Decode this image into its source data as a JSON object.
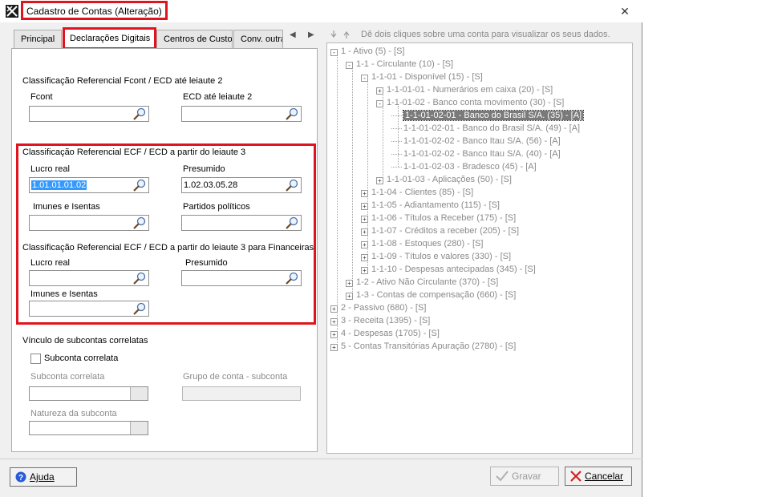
{
  "window": {
    "title": "Cadastro de Contas (Alteração)"
  },
  "tabs": [
    {
      "label": "Principal"
    },
    {
      "label": "Declarações Digitais"
    },
    {
      "label": "Centros de Custo"
    },
    {
      "label": "Conv. outra"
    }
  ],
  "form": {
    "section1": {
      "title": "Classificação Referencial Fcont / ECD até leiaute 2",
      "fcont_label": "Fcont",
      "fcont_value": "",
      "ecd_label": "ECD até leiaute 2",
      "ecd_value": ""
    },
    "section2": {
      "title": "Classificação Referencial ECF / ECD a partir do leiaute 3",
      "lucro_real_label": "Lucro real",
      "lucro_real_value": "1.01.01.01.02",
      "presumido_label": "Presumido",
      "presumido_value": "1.02.03.05.28",
      "imunes_label": "Imunes e Isentas",
      "imunes_value": "",
      "partidos_label": "Partidos políticos",
      "partidos_value": ""
    },
    "section3": {
      "title": "Classificação Referencial ECF / ECD a partir do leiaute 3 para Financeiras",
      "lucro_real_label": "Lucro real",
      "lucro_real_value": "",
      "presumido_label": "Presumido",
      "presumido_value": "",
      "imunes_label": "Imunes e Isentas",
      "imunes_value": ""
    },
    "section4": {
      "title": "Vínculo de subcontas correlatas",
      "checkbox_label": "Subconta correlata",
      "subconta_label": "Subconta correlata",
      "grupo_label": "Grupo de conta - subconta",
      "natureza_label": "Natureza da subconta"
    }
  },
  "tree": {
    "hint": "Dê dois cliques sobre uma conta para visualizar os seus dados.",
    "nodes": [
      {
        "text": "1 - Ativo (5) - [S]",
        "level": 0,
        "exp": "-"
      },
      {
        "text": "1-1 - Circulante (10) - [S]",
        "level": 1,
        "exp": "-"
      },
      {
        "text": "1-1-01 - Disponível (15) - [S]",
        "level": 2,
        "exp": "-"
      },
      {
        "text": "1-1-01-01 - Numerários em caixa (20) - [S]",
        "level": 3,
        "exp": "+"
      },
      {
        "text": "1-1-01-02 - Banco conta movimento (30) - [S]",
        "level": 3,
        "exp": "-"
      },
      {
        "text": "1-1-01-02-01 - Banco do Brasil S/A. (35) - [A]",
        "level": 4,
        "exp": "",
        "selected": true
      },
      {
        "text": "1-1-01-02-01 - Banco do Brasil S/A. (49) - [A]",
        "level": 4,
        "exp": ""
      },
      {
        "text": "1-1-01-02-02 - Banco Itau S/A. (56) - [A]",
        "level": 4,
        "exp": ""
      },
      {
        "text": "1-1-01-02-02 - Banco Itau S/A. (40) - [A]",
        "level": 4,
        "exp": ""
      },
      {
        "text": "1-1-01-02-03 - Bradesco (45) - [A]",
        "level": 4,
        "exp": ""
      },
      {
        "text": "1-1-01-03 - Aplicações (50) - [S]",
        "level": 3,
        "exp": "+"
      },
      {
        "text": "1-1-04 - Clientes (85) - [S]",
        "level": 2,
        "exp": "+"
      },
      {
        "text": "1-1-05 - Adiantamento (115) - [S]",
        "level": 2,
        "exp": "+"
      },
      {
        "text": "1-1-06 - Títulos a Receber (175) - [S]",
        "level": 2,
        "exp": "+"
      },
      {
        "text": "1-1-07 - Créditos a receber (205) - [S]",
        "level": 2,
        "exp": "+"
      },
      {
        "text": "1-1-08 - Estoques (280) - [S]",
        "level": 2,
        "exp": "+"
      },
      {
        "text": "1-1-09 - Títulos e valores (330) - [S]",
        "level": 2,
        "exp": "+"
      },
      {
        "text": "1-1-10 - Despesas antecipadas (345) - [S]",
        "level": 2,
        "exp": "+"
      },
      {
        "text": "1-2 - Ativo Não Circulante (370) - [S]",
        "level": 1,
        "exp": "+"
      },
      {
        "text": "1-3 - Contas de compensação (660) - [S]",
        "level": 1,
        "exp": "+"
      },
      {
        "text": "2 - Passivo (680) - [S]",
        "level": 0,
        "exp": "+"
      },
      {
        "text": "3 - Receita (1395) - [S]",
        "level": 0,
        "exp": "+"
      },
      {
        "text": "4 - Despesas (1705) - [S]",
        "level": 0,
        "exp": "+"
      },
      {
        "text": "5 - Contas Transitórias   Apuração (2780) - [S]",
        "level": 0,
        "exp": "+"
      }
    ]
  },
  "buttons": {
    "help": "Ajuda",
    "save": "Gravar",
    "cancel": "Cancelar"
  },
  "colors": {
    "highlight": "#e0141e",
    "selection": "#3399ff"
  }
}
